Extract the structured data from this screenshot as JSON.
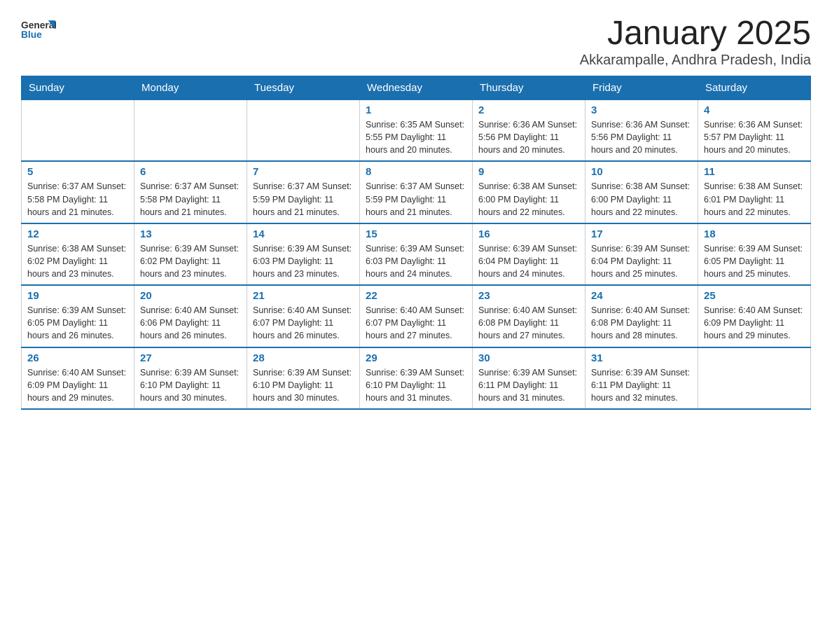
{
  "header": {
    "logo_general": "General",
    "logo_blue": "Blue",
    "title": "January 2025",
    "subtitle": "Akkarampalle, Andhra Pradesh, India"
  },
  "weekdays": [
    "Sunday",
    "Monday",
    "Tuesday",
    "Wednesday",
    "Thursday",
    "Friday",
    "Saturday"
  ],
  "weeks": [
    [
      {
        "day": "",
        "info": ""
      },
      {
        "day": "",
        "info": ""
      },
      {
        "day": "",
        "info": ""
      },
      {
        "day": "1",
        "info": "Sunrise: 6:35 AM\nSunset: 5:55 PM\nDaylight: 11 hours\nand 20 minutes."
      },
      {
        "day": "2",
        "info": "Sunrise: 6:36 AM\nSunset: 5:56 PM\nDaylight: 11 hours\nand 20 minutes."
      },
      {
        "day": "3",
        "info": "Sunrise: 6:36 AM\nSunset: 5:56 PM\nDaylight: 11 hours\nand 20 minutes."
      },
      {
        "day": "4",
        "info": "Sunrise: 6:36 AM\nSunset: 5:57 PM\nDaylight: 11 hours\nand 20 minutes."
      }
    ],
    [
      {
        "day": "5",
        "info": "Sunrise: 6:37 AM\nSunset: 5:58 PM\nDaylight: 11 hours\nand 21 minutes."
      },
      {
        "day": "6",
        "info": "Sunrise: 6:37 AM\nSunset: 5:58 PM\nDaylight: 11 hours\nand 21 minutes."
      },
      {
        "day": "7",
        "info": "Sunrise: 6:37 AM\nSunset: 5:59 PM\nDaylight: 11 hours\nand 21 minutes."
      },
      {
        "day": "8",
        "info": "Sunrise: 6:37 AM\nSunset: 5:59 PM\nDaylight: 11 hours\nand 21 minutes."
      },
      {
        "day": "9",
        "info": "Sunrise: 6:38 AM\nSunset: 6:00 PM\nDaylight: 11 hours\nand 22 minutes."
      },
      {
        "day": "10",
        "info": "Sunrise: 6:38 AM\nSunset: 6:00 PM\nDaylight: 11 hours\nand 22 minutes."
      },
      {
        "day": "11",
        "info": "Sunrise: 6:38 AM\nSunset: 6:01 PM\nDaylight: 11 hours\nand 22 minutes."
      }
    ],
    [
      {
        "day": "12",
        "info": "Sunrise: 6:38 AM\nSunset: 6:02 PM\nDaylight: 11 hours\nand 23 minutes."
      },
      {
        "day": "13",
        "info": "Sunrise: 6:39 AM\nSunset: 6:02 PM\nDaylight: 11 hours\nand 23 minutes."
      },
      {
        "day": "14",
        "info": "Sunrise: 6:39 AM\nSunset: 6:03 PM\nDaylight: 11 hours\nand 23 minutes."
      },
      {
        "day": "15",
        "info": "Sunrise: 6:39 AM\nSunset: 6:03 PM\nDaylight: 11 hours\nand 24 minutes."
      },
      {
        "day": "16",
        "info": "Sunrise: 6:39 AM\nSunset: 6:04 PM\nDaylight: 11 hours\nand 24 minutes."
      },
      {
        "day": "17",
        "info": "Sunrise: 6:39 AM\nSunset: 6:04 PM\nDaylight: 11 hours\nand 25 minutes."
      },
      {
        "day": "18",
        "info": "Sunrise: 6:39 AM\nSunset: 6:05 PM\nDaylight: 11 hours\nand 25 minutes."
      }
    ],
    [
      {
        "day": "19",
        "info": "Sunrise: 6:39 AM\nSunset: 6:05 PM\nDaylight: 11 hours\nand 26 minutes."
      },
      {
        "day": "20",
        "info": "Sunrise: 6:40 AM\nSunset: 6:06 PM\nDaylight: 11 hours\nand 26 minutes."
      },
      {
        "day": "21",
        "info": "Sunrise: 6:40 AM\nSunset: 6:07 PM\nDaylight: 11 hours\nand 26 minutes."
      },
      {
        "day": "22",
        "info": "Sunrise: 6:40 AM\nSunset: 6:07 PM\nDaylight: 11 hours\nand 27 minutes."
      },
      {
        "day": "23",
        "info": "Sunrise: 6:40 AM\nSunset: 6:08 PM\nDaylight: 11 hours\nand 27 minutes."
      },
      {
        "day": "24",
        "info": "Sunrise: 6:40 AM\nSunset: 6:08 PM\nDaylight: 11 hours\nand 28 minutes."
      },
      {
        "day": "25",
        "info": "Sunrise: 6:40 AM\nSunset: 6:09 PM\nDaylight: 11 hours\nand 29 minutes."
      }
    ],
    [
      {
        "day": "26",
        "info": "Sunrise: 6:40 AM\nSunset: 6:09 PM\nDaylight: 11 hours\nand 29 minutes."
      },
      {
        "day": "27",
        "info": "Sunrise: 6:39 AM\nSunset: 6:10 PM\nDaylight: 11 hours\nand 30 minutes."
      },
      {
        "day": "28",
        "info": "Sunrise: 6:39 AM\nSunset: 6:10 PM\nDaylight: 11 hours\nand 30 minutes."
      },
      {
        "day": "29",
        "info": "Sunrise: 6:39 AM\nSunset: 6:10 PM\nDaylight: 11 hours\nand 31 minutes."
      },
      {
        "day": "30",
        "info": "Sunrise: 6:39 AM\nSunset: 6:11 PM\nDaylight: 11 hours\nand 31 minutes."
      },
      {
        "day": "31",
        "info": "Sunrise: 6:39 AM\nSunset: 6:11 PM\nDaylight: 11 hours\nand 32 minutes."
      },
      {
        "day": "",
        "info": ""
      }
    ]
  ]
}
